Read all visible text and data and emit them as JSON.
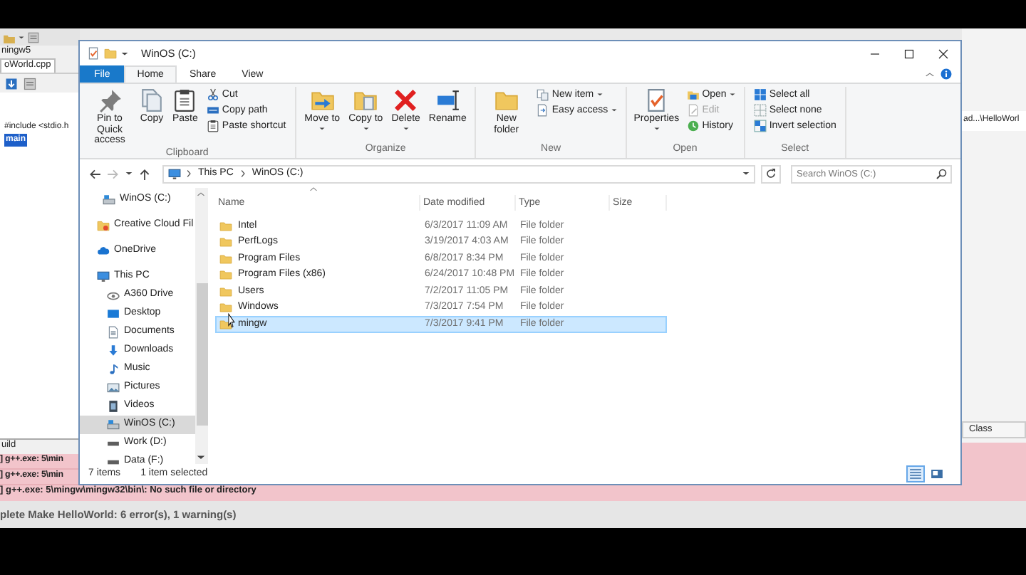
{
  "ide": {
    "project_title": "ningw5",
    "file_tab": "oWorld.cpp",
    "code_lines": [
      {
        "text": "#include <stdio.h",
        "highlighted": false
      },
      {
        "text": "main",
        "highlighted": true
      }
    ],
    "build_tab": "uild",
    "log_rows": [
      "] g++.exe: 5\\min",
      "] g++.exe: 5\\min"
    ],
    "last_log_row": "] g++.exe: 5\\mingw\\mingw32\\bin\\: No such file or directory",
    "summary": "plete Make HelloWorld: 6 error(s), 1 warning(s)",
    "path_field": "ad...\\HelloWorl",
    "class_tab": "Class"
  },
  "explorer": {
    "title": "WinOS (C:)",
    "tabs": [
      {
        "label": "File",
        "kind": "file",
        "selected": false
      },
      {
        "label": "Home",
        "kind": "tab",
        "selected": true
      },
      {
        "label": "Share",
        "kind": "tab",
        "selected": false
      },
      {
        "label": "View",
        "kind": "tab",
        "selected": false
      }
    ],
    "ribbon": [
      {
        "label": "Clipboard",
        "items": [
          {
            "label": "Pin to Quick access",
            "kind": "large",
            "dropdown": false,
            "disabled": false
          },
          {
            "label": "Copy",
            "kind": "large",
            "dropdown": false,
            "disabled": false
          },
          {
            "label": "Paste",
            "kind": "large",
            "dropdown": false,
            "disabled": false
          },
          {
            "label": "Cut",
            "kind": "small",
            "dropdown": false,
            "disabled": false
          },
          {
            "label": "Copy path",
            "kind": "small",
            "dropdown": false,
            "disabled": false
          },
          {
            "label": "Paste shortcut",
            "kind": "small",
            "dropdown": false,
            "disabled": false
          }
        ]
      },
      {
        "label": "Organize",
        "items": [
          {
            "label": "Move to",
            "kind": "large",
            "dropdown": true,
            "disabled": false
          },
          {
            "label": "Copy to",
            "kind": "large",
            "dropdown": true,
            "disabled": false
          },
          {
            "label": "Delete",
            "kind": "large",
            "dropdown": true,
            "disabled": false
          },
          {
            "label": "Rename",
            "kind": "large",
            "dropdown": false,
            "disabled": false
          }
        ]
      },
      {
        "label": "New",
        "items": [
          {
            "label": "New folder",
            "kind": "large",
            "dropdown": false,
            "disabled": false
          },
          {
            "label": "New item",
            "kind": "small",
            "dropdown": true,
            "disabled": false
          },
          {
            "label": "Easy access",
            "kind": "small",
            "dropdown": true,
            "disabled": false
          }
        ]
      },
      {
        "label": "Open",
        "items": [
          {
            "label": "Properties",
            "kind": "large",
            "dropdown": true,
            "disabled": false
          },
          {
            "label": "Open",
            "kind": "small",
            "dropdown": true,
            "disabled": false
          },
          {
            "label": "Edit",
            "kind": "small",
            "dropdown": false,
            "disabled": true
          },
          {
            "label": "History",
            "kind": "small",
            "dropdown": false,
            "disabled": false
          }
        ]
      },
      {
        "label": "Select",
        "items": [
          {
            "label": "Select all",
            "kind": "small",
            "dropdown": false,
            "disabled": false
          },
          {
            "label": "Select none",
            "kind": "small",
            "dropdown": false,
            "disabled": false
          },
          {
            "label": "Invert selection",
            "kind": "small",
            "dropdown": false,
            "disabled": false
          }
        ]
      }
    ],
    "address": {
      "crumbs": [
        "This PC",
        "WinOS (C:)"
      ]
    },
    "search": {
      "placeholder": "Search WinOS (C:)"
    },
    "nav": [
      {
        "label": "WinOS (C:)",
        "selected": false
      },
      {
        "label": "Creative Cloud Fil",
        "selected": false
      },
      {
        "label": "OneDrive",
        "selected": false
      },
      {
        "label": "This PC",
        "selected": false,
        "children": [
          {
            "label": "A360 Drive",
            "selected": false
          },
          {
            "label": "Desktop",
            "selected": false
          },
          {
            "label": "Documents",
            "selected": false
          },
          {
            "label": "Downloads",
            "selected": false
          },
          {
            "label": "Music",
            "selected": false
          },
          {
            "label": "Pictures",
            "selected": false
          },
          {
            "label": "Videos",
            "selected": false
          },
          {
            "label": "WinOS (C:)",
            "selected": true
          },
          {
            "label": "Work (D:)",
            "selected": false
          },
          {
            "label": "Data (F:)",
            "selected": false
          }
        ]
      }
    ],
    "columns": [
      "Name",
      "Date modified",
      "Type",
      "Size"
    ],
    "files": [
      {
        "name": "Intel",
        "date": "6/3/2017 11:09 AM",
        "type": "File folder",
        "selected": false
      },
      {
        "name": "PerfLogs",
        "date": "3/19/2017 4:03 AM",
        "type": "File folder",
        "selected": false
      },
      {
        "name": "Program Files",
        "date": "6/8/2017 8:34 PM",
        "type": "File folder",
        "selected": false
      },
      {
        "name": "Program Files (x86)",
        "date": "6/24/2017 10:48 PM",
        "type": "File folder",
        "selected": false
      },
      {
        "name": "Users",
        "date": "7/2/2017 11:05 PM",
        "type": "File folder",
        "selected": false
      },
      {
        "name": "Windows",
        "date": "7/3/2017 7:54 PM",
        "type": "File folder",
        "selected": false
      },
      {
        "name": "mingw",
        "date": "7/3/2017 9:41 PM",
        "type": "File folder",
        "selected": true
      }
    ],
    "status": {
      "count": "7 items",
      "selection": "1 item selected"
    },
    "view_buttons": [
      {
        "selected": true
      },
      {
        "selected": false
      }
    ]
  }
}
